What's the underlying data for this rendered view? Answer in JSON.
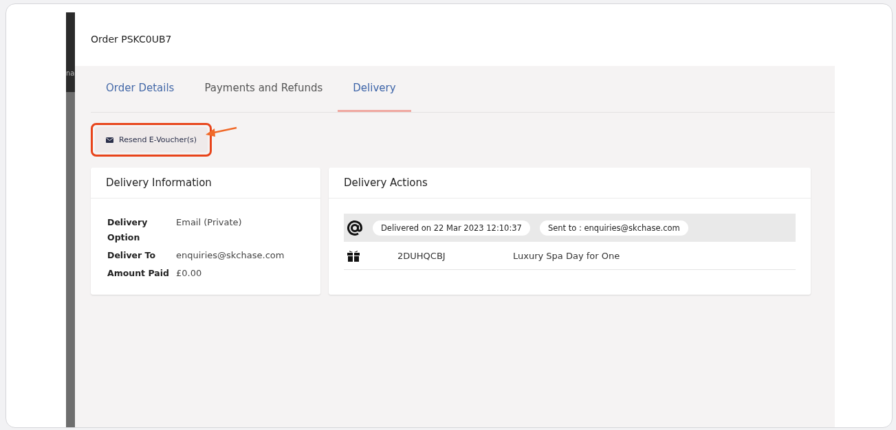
{
  "backdrop": {
    "fragment": "na"
  },
  "modal": {
    "title": "Order PSKC0UB7"
  },
  "tabs": [
    {
      "label": "Order Details",
      "selected": false
    },
    {
      "label": "Payments and Refunds",
      "selected": false
    },
    {
      "label": "Delivery",
      "selected": true
    }
  ],
  "resend_button": {
    "label": "Resend E-Voucher(s)",
    "highlighted": true
  },
  "delivery_information": {
    "title": "Delivery Information",
    "rows": [
      {
        "label": "Delivery Option",
        "value": "Email (Private)"
      },
      {
        "label": "Deliver To",
        "value": "enquiries@skchase.com"
      },
      {
        "label": "Amount Paid",
        "value": "£0.00"
      }
    ]
  },
  "delivery_actions": {
    "title": "Delivery Actions",
    "event": {
      "delivered": "Delivered on 22 Mar 2023 12:10:37",
      "sent_to": "Sent to : enquiries@skchase.com"
    },
    "items": [
      {
        "code": "2DUHQCBJ",
        "product": "Luxury Spa Day for One"
      }
    ]
  }
}
